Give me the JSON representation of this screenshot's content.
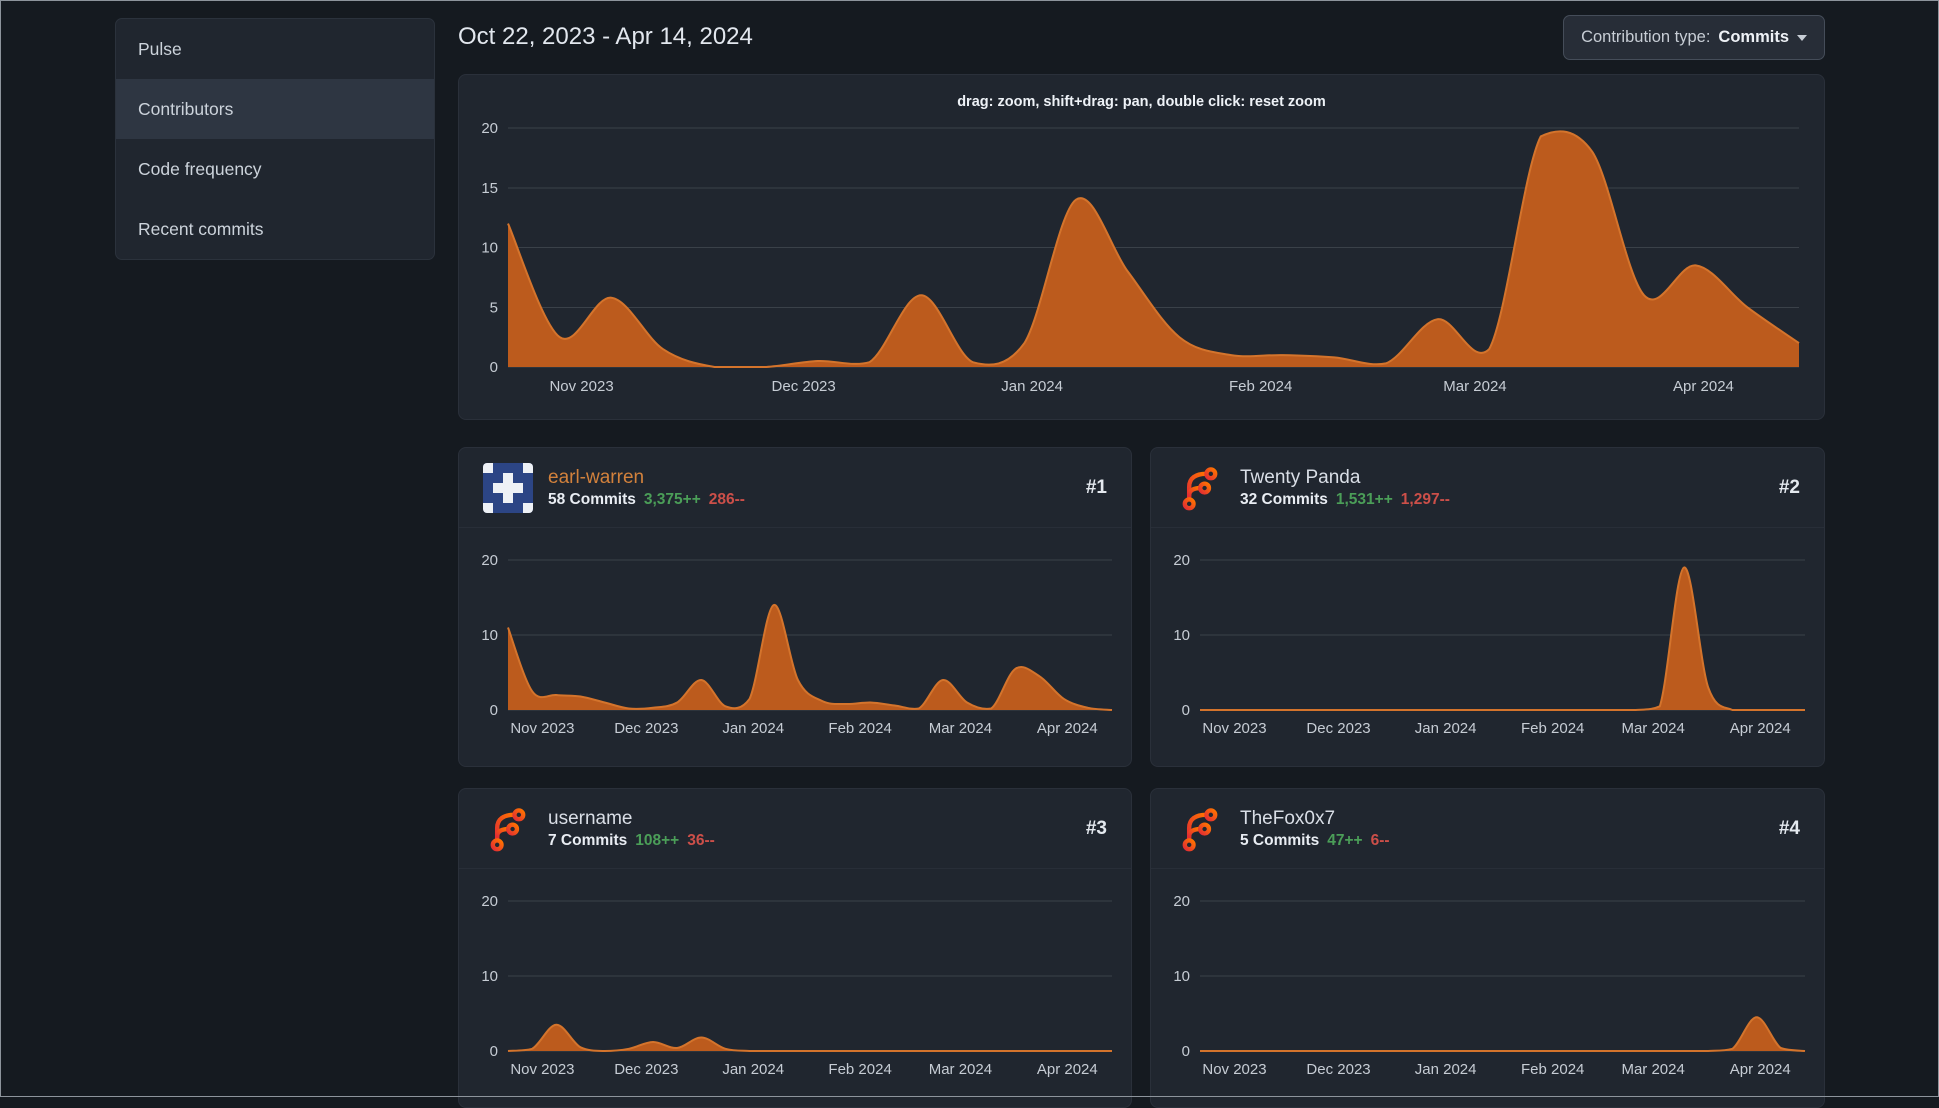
{
  "sidebar": {
    "items": [
      {
        "label": "Pulse",
        "active": false
      },
      {
        "label": "Contributors",
        "active": true
      },
      {
        "label": "Code frequency",
        "active": false
      },
      {
        "label": "Recent commits",
        "active": false
      }
    ]
  },
  "header": {
    "date_range": "Oct 22, 2023 - Apr 14, 2024",
    "contribution_type_label": "Contribution type:",
    "contribution_type_value": "Commits"
  },
  "main_chart": {
    "hint": "drag: zoom, shift+drag: pan, double click: reset zoom"
  },
  "contributors": [
    {
      "name": "earl-warren",
      "rank": "#1",
      "commits": "58 Commits",
      "additions": "3,375++",
      "deletions": "286--",
      "avatar": "identicon"
    },
    {
      "name": "Twenty Panda",
      "rank": "#2",
      "commits": "32 Commits",
      "additions": "1,531++",
      "deletions": "1,297--",
      "avatar": "forgejo-logo"
    },
    {
      "name": "username",
      "rank": "#3",
      "commits": "7 Commits",
      "additions": "108++",
      "deletions": "36--",
      "avatar": "forgejo-logo"
    },
    {
      "name": "TheFox0x7",
      "rank": "#4",
      "commits": "5 Commits",
      "additions": "47++",
      "deletions": "6--",
      "avatar": "forgejo-logo"
    }
  ],
  "colors": {
    "chart_fill": "#bc5b1d",
    "chart_stroke": "#d4742c",
    "grid": "#3a4149",
    "axis_text": "#c6ccd4",
    "additions_green": "#4b9e58",
    "deletions_red": "#cc4f49",
    "accent_orange": "#d2813c"
  },
  "chart_data": {
    "type": "area",
    "x_axis": {
      "range": "Oct 22, 2023 - Apr 14, 2024",
      "unit": "commits per week",
      "tick_labels": [
        "Nov 2023",
        "Dec 2023",
        "Jan 2024",
        "Feb 2024",
        "Mar 2024",
        "Apr 2024"
      ],
      "tick_fractions": [
        0.057,
        0.229,
        0.406,
        0.583,
        0.749,
        0.926
      ]
    },
    "main": {
      "name": "all-contributions",
      "ylim": [
        0,
        20
      ],
      "y_ticks": [
        0,
        5,
        10,
        15,
        20
      ],
      "values": [
        12,
        2.5,
        5.8,
        1.5,
        0,
        0,
        0.5,
        0.4,
        6,
        0.4,
        2,
        14,
        8,
        2.5,
        1,
        1,
        0.8,
        0.3,
        4,
        1.5,
        19.3,
        18,
        6,
        8.5,
        5,
        2
      ]
    },
    "contributors": [
      {
        "name": "earl-warren",
        "ylim": [
          0,
          20
        ],
        "y_ticks": [
          0,
          10,
          20
        ],
        "values": [
          11,
          2.5,
          2,
          1.8,
          1,
          0.2,
          0.3,
          1,
          4,
          0.5,
          1.5,
          14,
          4,
          1.2,
          0.8,
          1,
          0.6,
          0.2,
          4,
          1,
          0.2,
          5.5,
          4.5,
          1.5,
          0.3,
          0
        ]
      },
      {
        "name": "Twenty Panda",
        "ylim": [
          0,
          20
        ],
        "y_ticks": [
          0,
          10,
          20
        ],
        "values": [
          0,
          0,
          0,
          0,
          0,
          0,
          0,
          0,
          0,
          0,
          0,
          0,
          0,
          0,
          0,
          0,
          0,
          0,
          0,
          0.5,
          19,
          3,
          0,
          0,
          0,
          0
        ]
      },
      {
        "name": "username",
        "ylim": [
          0,
          20
        ],
        "y_ticks": [
          0,
          10,
          20
        ],
        "values": [
          0,
          0.3,
          3.5,
          0.5,
          0,
          0.3,
          1.2,
          0.4,
          1.8,
          0.3,
          0,
          0,
          0,
          0,
          0,
          0,
          0,
          0,
          0,
          0,
          0,
          0,
          0,
          0,
          0,
          0
        ]
      },
      {
        "name": "TheFox0x7",
        "ylim": [
          0,
          20
        ],
        "y_ticks": [
          0,
          10,
          20
        ],
        "values": [
          0,
          0,
          0,
          0,
          0,
          0,
          0,
          0,
          0,
          0,
          0,
          0,
          0,
          0,
          0,
          0,
          0,
          0,
          0,
          0,
          0,
          0,
          0.3,
          4.5,
          0.4,
          0
        ]
      }
    ]
  }
}
